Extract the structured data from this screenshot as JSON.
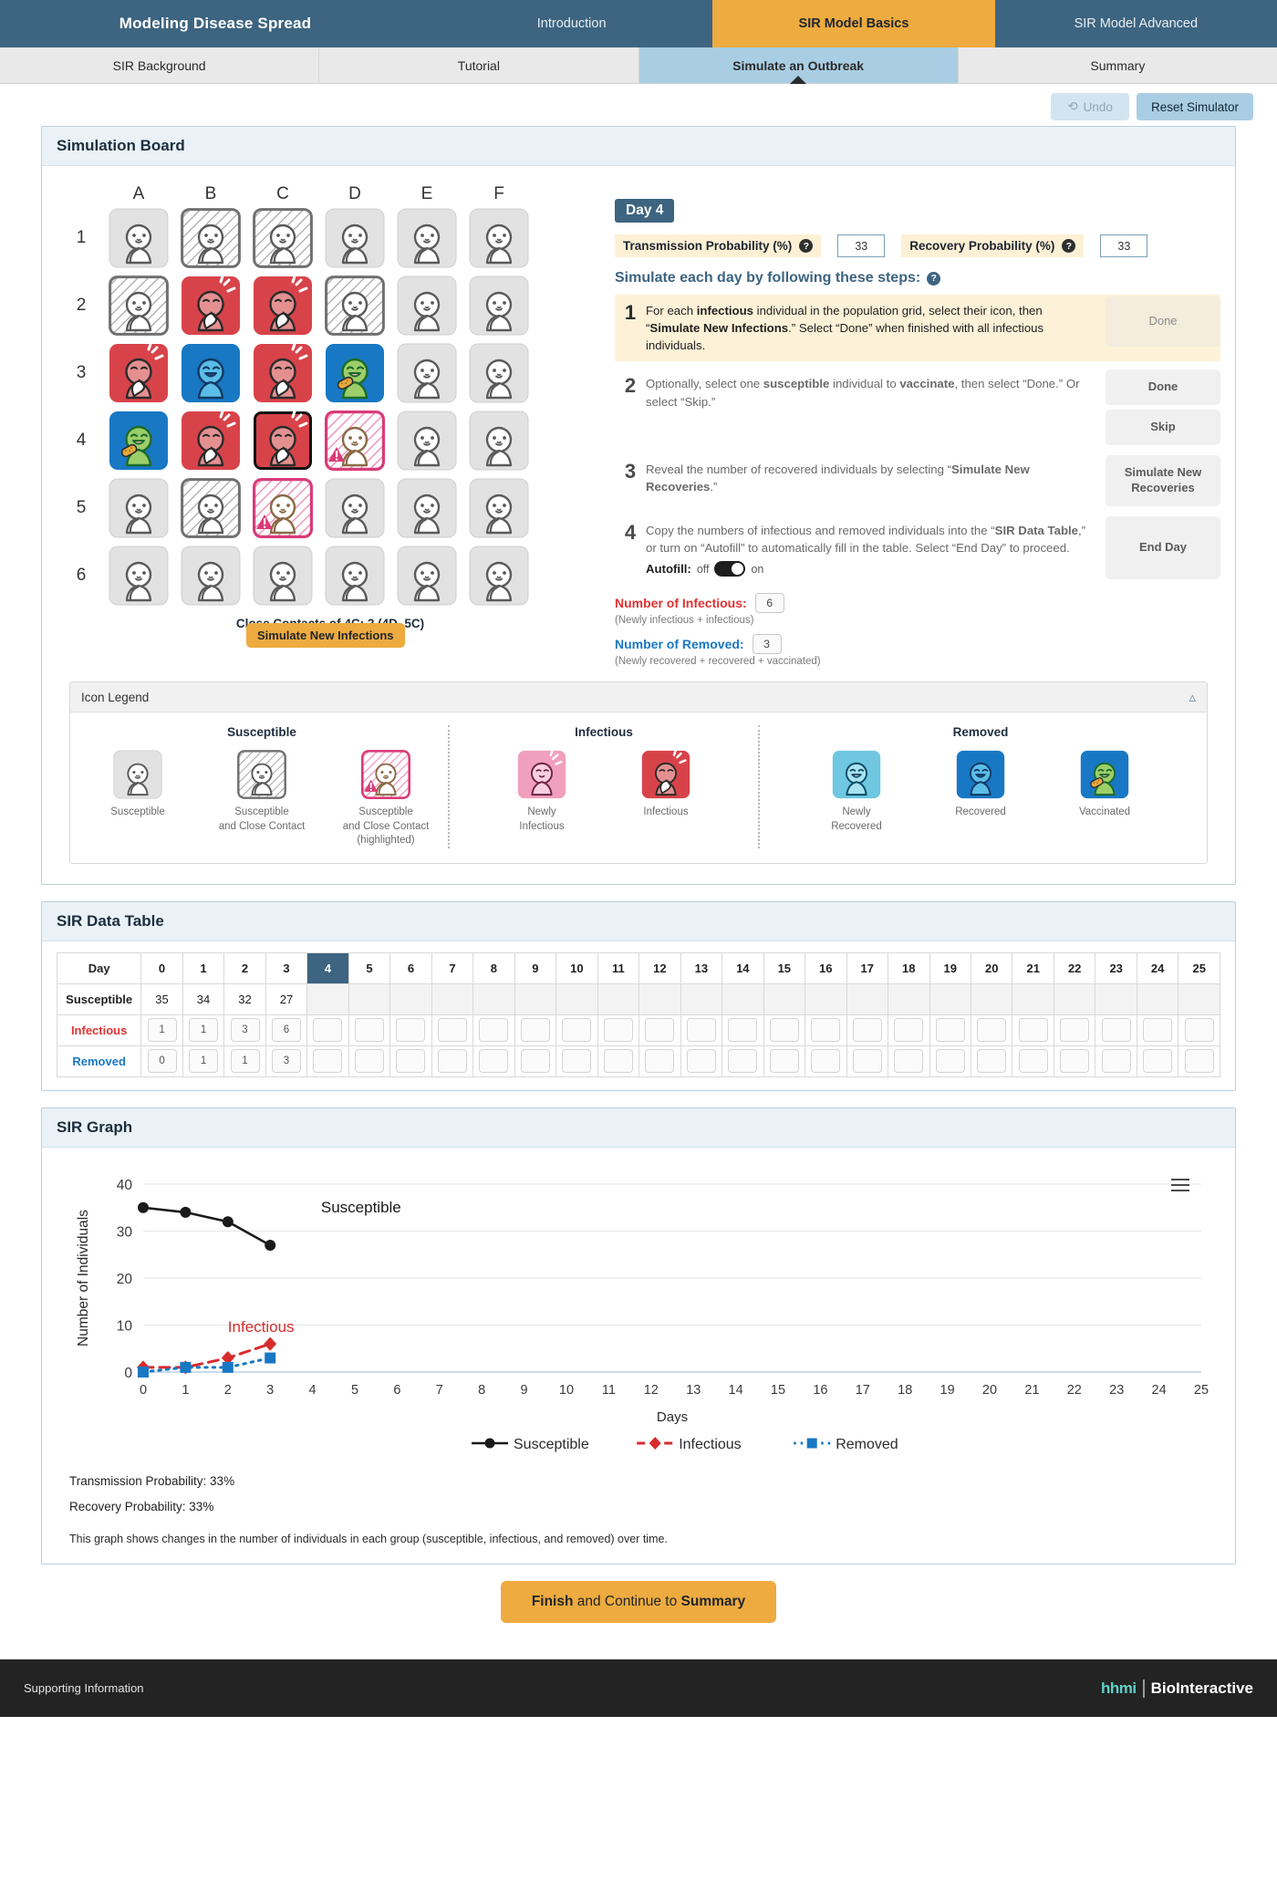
{
  "topnav": {
    "brand": "Modeling Disease Spread",
    "tabs": [
      {
        "label": "Introduction",
        "active": false
      },
      {
        "label": "SIR Model Basics",
        "active": true
      },
      {
        "label": "SIR Model Advanced",
        "active": false
      }
    ]
  },
  "subnav": {
    "tabs": [
      {
        "label": "SIR Background",
        "active": false
      },
      {
        "label": "Tutorial",
        "active": false
      },
      {
        "label": "Simulate an Outbreak",
        "active": true
      },
      {
        "label": "Summary",
        "active": false
      }
    ]
  },
  "actionbar": {
    "undo_label": "Undo",
    "reset_label": "Reset Simulator"
  },
  "board": {
    "title": "Simulation Board",
    "columns": [
      "A",
      "B",
      "C",
      "D",
      "E",
      "F"
    ],
    "rows": [
      "1",
      "2",
      "3",
      "4",
      "5",
      "6"
    ],
    "cells": [
      [
        "susceptible",
        "contact",
        "contact",
        "susceptible",
        "susceptible",
        "susceptible"
      ],
      [
        "contact",
        "infectious",
        "infectious",
        "contact",
        "susceptible",
        "susceptible"
      ],
      [
        "infectious",
        "recovered",
        "infectious",
        "vaccinated",
        "susceptible",
        "susceptible"
      ],
      [
        "vaccinated",
        "infectious",
        "infectious-selected",
        "contact-highlight",
        "susceptible",
        "susceptible"
      ],
      [
        "susceptible",
        "contact",
        "contact-highlight",
        "susceptible",
        "susceptible",
        "susceptible"
      ],
      [
        "susceptible",
        "susceptible",
        "susceptible",
        "susceptible",
        "susceptible",
        "susceptible"
      ]
    ],
    "tooltip_button": "Simulate New Infections",
    "close_contacts": "Close Contacts of 4C: 2 (4D, 5C)"
  },
  "steps_panel": {
    "day_badge": "Day 4",
    "transmission_label": "Transmission Probability (%)",
    "transmission_value": "33",
    "recovery_label": "Recovery Probability (%)",
    "recovery_value": "33",
    "steps_title": "Simulate each day by following these steps:",
    "help_icon": "?",
    "steps": [
      {
        "num": "1",
        "text_parts": [
          "For each ",
          "infectious",
          " individual in the population grid, select their icon, then “",
          "Simulate New Infections",
          ".” Select “Done” when finished with all infectious individuals."
        ],
        "buttons": [
          "Done"
        ],
        "active": true
      },
      {
        "num": "2",
        "text_parts": [
          "Optionally, select one ",
          "susceptible",
          " individual to ",
          "vaccinate",
          ", then select “Done.” Or select “Skip.”"
        ],
        "buttons": [
          "Done",
          "Skip"
        ],
        "active": false
      },
      {
        "num": "3",
        "text_parts": [
          "Reveal the number of recovered individuals by selecting “",
          "Simulate New Recoveries",
          ".”"
        ],
        "buttons": [
          "Simulate New Recoveries"
        ],
        "active": false
      },
      {
        "num": "4",
        "text_parts": [
          "Copy the numbers of infectious and removed individuals into the “",
          "SIR Data Table",
          ",” or turn on “Autofill” to automatically fill in the table. Select “End Day” to proceed."
        ],
        "buttons": [
          "End Day"
        ],
        "active": false
      }
    ],
    "autofill_label": "Autofill:",
    "autofill_off": "off",
    "autofill_on": "on",
    "infectious_label": "Number of Infectious:",
    "infectious_value": "6",
    "infectious_sub": "(Newly infectious + infectious)",
    "removed_label": "Number of Removed:",
    "removed_value": "3",
    "removed_sub": "(Newly recovered + recovered + vaccinated)"
  },
  "legend": {
    "title": "Icon Legend",
    "collapse_icon": "chevron-up",
    "groups": [
      {
        "title": "Susceptible",
        "items": [
          {
            "kind": "susceptible",
            "caption": "Susceptible"
          },
          {
            "kind": "contact",
            "caption": "Susceptible\nand Close Contact"
          },
          {
            "kind": "contact-highlight",
            "caption": "Susceptible\nand Close Contact\n(highlighted)"
          }
        ]
      },
      {
        "title": "Infectious",
        "items": [
          {
            "kind": "newly-infectious",
            "caption": "Newly\nInfectious"
          },
          {
            "kind": "infectious",
            "caption": "Infectious"
          }
        ]
      },
      {
        "title": "Removed",
        "items": [
          {
            "kind": "newly-recovered",
            "caption": "Newly\nRecovered"
          },
          {
            "kind": "recovered",
            "caption": "Recovered"
          },
          {
            "kind": "vaccinated",
            "caption": "Vaccinated"
          }
        ]
      }
    ]
  },
  "data_table": {
    "title": "SIR Data Table",
    "day_label": "Day",
    "days": [
      "0",
      "1",
      "2",
      "3",
      "4",
      "5",
      "6",
      "7",
      "8",
      "9",
      "10",
      "11",
      "12",
      "13",
      "14",
      "15",
      "16",
      "17",
      "18",
      "19",
      "20",
      "21",
      "22",
      "23",
      "24",
      "25"
    ],
    "selected_day": "4",
    "rows": [
      {
        "label": "Susceptible",
        "values": [
          "35",
          "34",
          "32",
          "27",
          "",
          "",
          "",
          "",
          "",
          "",
          "",
          "",
          "",
          "",
          "",
          "",
          "",
          "",
          "",
          "",
          "",
          "",
          "",
          "",
          "",
          ""
        ],
        "style": "plain"
      },
      {
        "label": "Infectious",
        "values": [
          "1",
          "1",
          "3",
          "6",
          "",
          "",
          "",
          "",
          "",
          "",
          "",
          "",
          "",
          "",
          "",
          "",
          "",
          "",
          "",
          "",
          "",
          "",
          "",
          "",
          "",
          ""
        ],
        "style": "input"
      },
      {
        "label": "Removed",
        "values": [
          "0",
          "1",
          "1",
          "3",
          "",
          "",
          "",
          "",
          "",
          "",
          "",
          "",
          "",
          "",
          "",
          "",
          "",
          "",
          "",
          "",
          "",
          "",
          "",
          "",
          "",
          ""
        ],
        "style": "input"
      }
    ]
  },
  "graph_panel": {
    "title": "SIR Graph",
    "menu_icon": "hamburger-menu",
    "transmission_note": "Transmission Probability: 33%",
    "recovery_note": "Recovery Probability: 33%",
    "caption": "This graph shows changes in the number of individuals in each group (susceptible, infectious, and removed) over time."
  },
  "chart_data": {
    "type": "line",
    "title": "SIR Graph",
    "xlabel": "Days",
    "ylabel": "Number of Individuals",
    "x": [
      0,
      1,
      2,
      3,
      4,
      5,
      6,
      7,
      8,
      9,
      10,
      11,
      12,
      13,
      14,
      15,
      16,
      17,
      18,
      19,
      20,
      21,
      22,
      23,
      24,
      25
    ],
    "xticks": [
      "0",
      "1",
      "2",
      "3",
      "4",
      "5",
      "6",
      "7",
      "8",
      "9",
      "10",
      "11",
      "12",
      "13",
      "14",
      "15",
      "16",
      "17",
      "18",
      "19",
      "20",
      "21",
      "22",
      "23",
      "24",
      "25"
    ],
    "yticks": [
      0,
      10,
      20,
      30,
      40
    ],
    "ylim": [
      0,
      40
    ],
    "xlim": [
      0,
      25
    ],
    "grid": true,
    "legend_position": "bottom",
    "annotations": [
      {
        "text": "Susceptible",
        "x": 4.2,
        "y": 34,
        "color": "#1a1a1a"
      },
      {
        "text": "Infectious",
        "x": 2.0,
        "y": 8.5,
        "color": "#d82c2c"
      }
    ],
    "series": [
      {
        "name": "Susceptible",
        "values": [
          35,
          34,
          32,
          27
        ],
        "color": "#1a1a1a",
        "marker": "circle",
        "dash": "solid"
      },
      {
        "name": "Infectious",
        "values": [
          1,
          1,
          3,
          6
        ],
        "color": "#d82c2c",
        "marker": "diamond",
        "dash": "dashed"
      },
      {
        "name": "Removed",
        "values": [
          0,
          1,
          1,
          3
        ],
        "color": "#1878c4",
        "marker": "square",
        "dash": "dotted"
      }
    ]
  },
  "finish": {
    "label_bold1": "Finish",
    "label_mid": " and Continue to ",
    "label_bold2": "Summary"
  },
  "footer": {
    "supporting": "Supporting Information",
    "hhmi": "hhmi",
    "bio": "BioInteractive"
  },
  "colors": {
    "navy": "#3d6480",
    "amber": "#eeab3f",
    "light_blue": "#a9cee3",
    "infectious_red": "#d8434a",
    "newly_infectious_pink": "#f0a0bd",
    "recovered_blue": "#1878c4",
    "newly_recovered_blue": "#6fc7e0",
    "vaccinated_green": "#8fc862",
    "highlight_pink": "#d93b78"
  }
}
